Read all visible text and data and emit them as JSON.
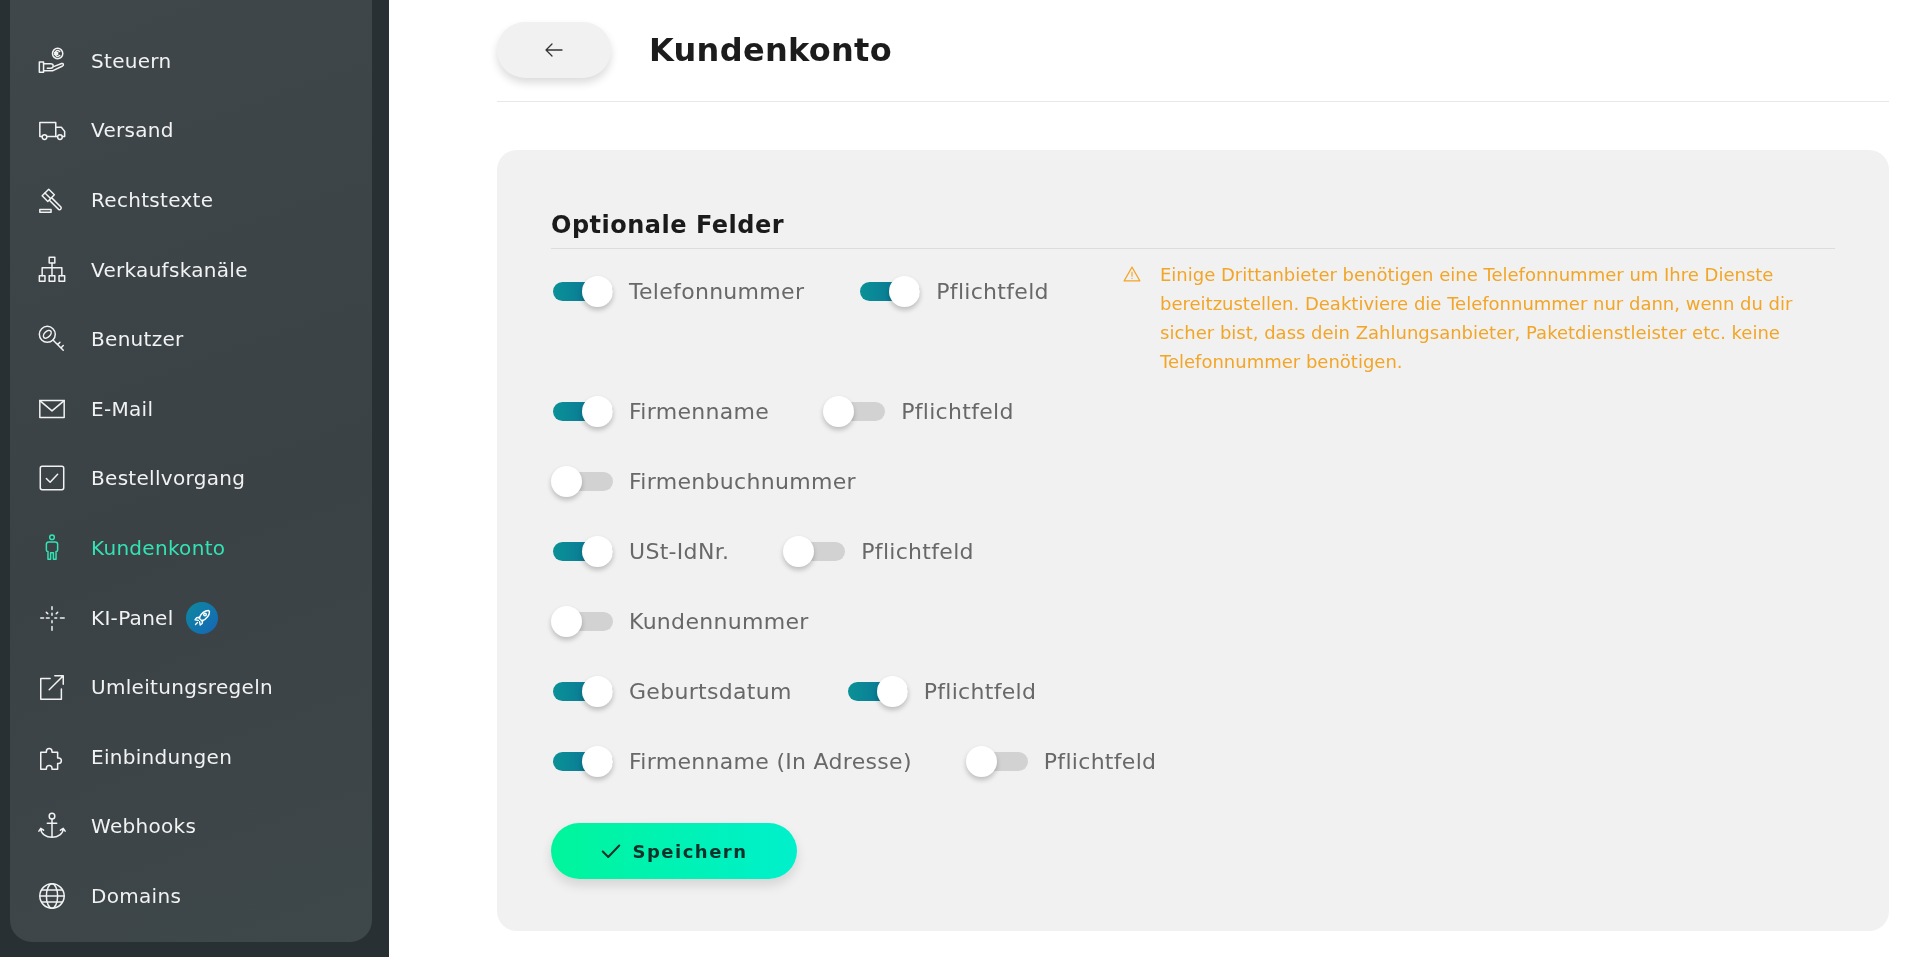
{
  "sidebar": {
    "items": [
      {
        "label": "Steuern",
        "selected": false,
        "badge": false
      },
      {
        "label": "Versand",
        "selected": false,
        "badge": false
      },
      {
        "label": "Rechtstexte",
        "selected": false,
        "badge": false
      },
      {
        "label": "Verkaufskanäle",
        "selected": false,
        "badge": false
      },
      {
        "label": "Benutzer",
        "selected": false,
        "badge": false
      },
      {
        "label": "E-Mail",
        "selected": false,
        "badge": false
      },
      {
        "label": "Bestellvorgang",
        "selected": false,
        "badge": false
      },
      {
        "label": "Kundenkonto",
        "selected": true,
        "badge": false
      },
      {
        "label": "KI-Panel",
        "selected": false,
        "badge": true
      },
      {
        "label": "Umleitungsregeln",
        "selected": false,
        "badge": false
      },
      {
        "label": "Einbindungen",
        "selected": false,
        "badge": false
      },
      {
        "label": "Webhooks",
        "selected": false,
        "badge": false
      },
      {
        "label": "Domains",
        "selected": false,
        "badge": false
      }
    ]
  },
  "header": {
    "title": "Kundenkonto"
  },
  "section": {
    "title": "Optionale Felder",
    "fields": [
      {
        "label": "Telefonnummer",
        "on": true,
        "required": {
          "label": "Pflichtfeld",
          "on": true
        },
        "notice": "Einige Drittanbieter benötigen eine Telefonnummer um Ihre Dienste bereitzustellen. Deaktiviere die Telefonnummer nur dann, wenn du dir sicher bist, dass dein Zahlungsanbieter, Paketdienstleister etc. keine Telefonnummer benötigen."
      },
      {
        "label": "Firmenname",
        "on": true,
        "required": {
          "label": "Pflichtfeld",
          "on": false
        }
      },
      {
        "label": "Firmenbuchnummer",
        "on": false
      },
      {
        "label": "USt-IdNr.",
        "on": true,
        "required": {
          "label": "Pflichtfeld",
          "on": false
        }
      },
      {
        "label": "Kundennummer",
        "on": false
      },
      {
        "label": "Geburtsdatum",
        "on": true,
        "required": {
          "label": "Pflichtfeld",
          "on": true
        }
      },
      {
        "label": "Firmenname (In Adresse)",
        "on": true,
        "required": {
          "label": "Pflichtfeld",
          "on": false
        }
      }
    ]
  },
  "save_button": {
    "label": "Speichern"
  }
}
